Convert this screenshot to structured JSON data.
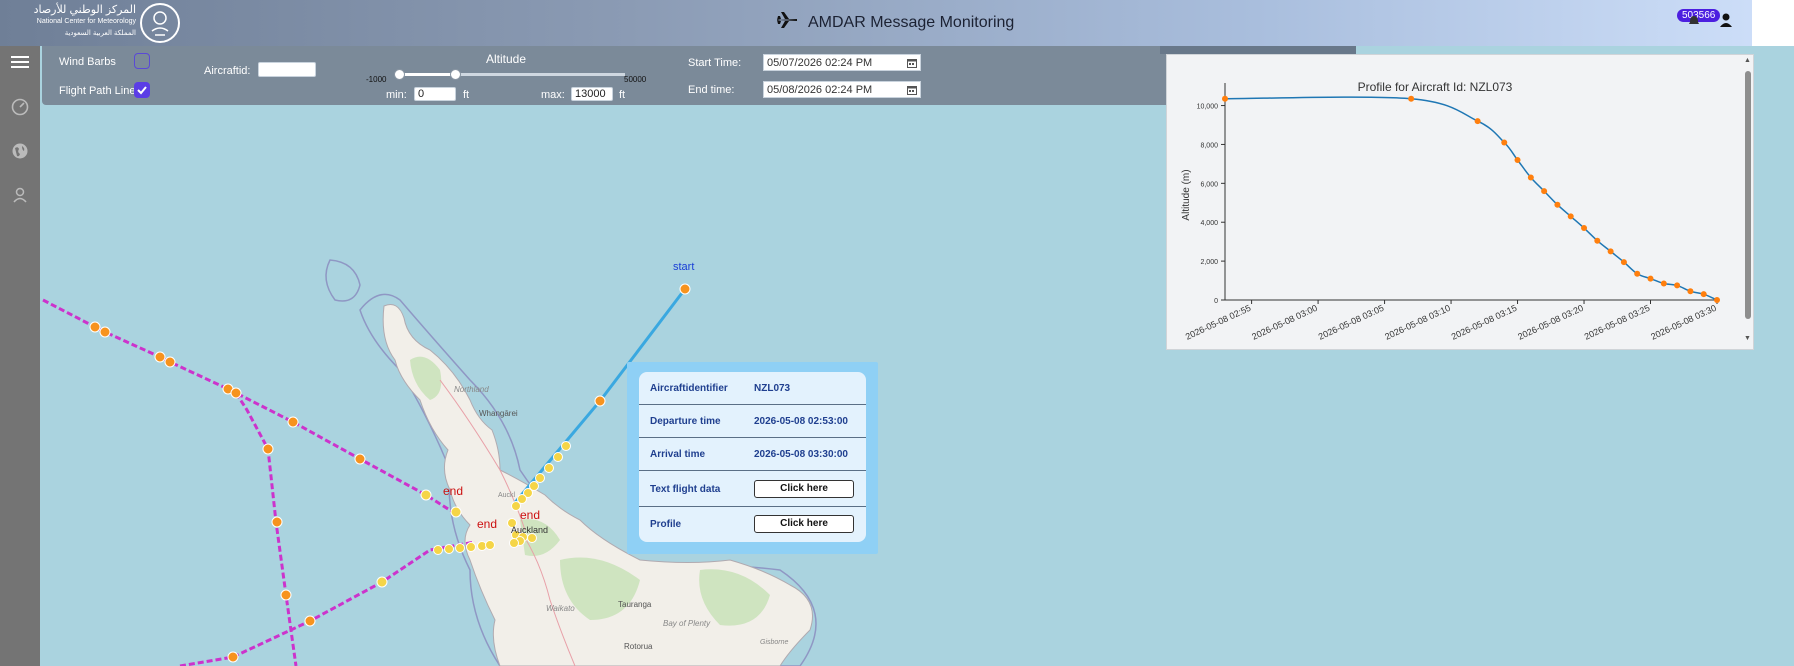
{
  "header": {
    "logo_ar": "المركز الوطني للأرصاد",
    "logo_en": "National Center for Meteorology",
    "logo_ar2": "المملكة العربية السعودية",
    "title": "AMDAR Message Monitoring",
    "badge": "503566"
  },
  "toolbar": {
    "wind_barbs_label": "Wind Barbs",
    "wind_barbs_checked": false,
    "flight_path_label": "Flight Path Line",
    "flight_path_checked": true,
    "aircraftid_label": "Aircraftid:",
    "aircraftid_value": "",
    "altitude_label": "Altitude",
    "slider_min_label": "-1000",
    "slider_max_label": "50000",
    "min_label": "min:",
    "min_value": "0",
    "max_label": "max:",
    "max_value": "13000",
    "unit": "ft",
    "start_label": "Start Time:",
    "start_value": "05/07/2026 02:24 PM",
    "end_label": "End time:",
    "end_value": "05/08/2026 02:24 PM"
  },
  "map": {
    "labels": {
      "start": "start",
      "end": "end",
      "northland": "Northland",
      "whangarei": "Whangārei",
      "auckland": "Auckland",
      "auckl": "Auckl",
      "tauranga": "Tauranga",
      "bay_of_plenty": "Bay of Plenty",
      "waikato": "Waikato",
      "rotorua": "Rotorua",
      "gisborne": "Gisborne"
    },
    "colors": {
      "water": "#aad3df",
      "land": "#f2efe9",
      "path_magenta": "#cc33cc",
      "path_blue": "#3aa8e0",
      "point_orange": "#f7931e",
      "point_yellow": "#f5d547",
      "end_text": "#cc1111",
      "start_text": "#1a3fd6"
    }
  },
  "popup": {
    "rows": [
      {
        "label": "Aircraftidentifier",
        "value": "NZL073"
      },
      {
        "label": "Departure time",
        "value": "2026-05-08 02:53:00"
      },
      {
        "label": "Arrival time",
        "value": "2026-05-08 03:30:00"
      },
      {
        "label": "Text flight data",
        "button": "Click here"
      },
      {
        "label": "Profile",
        "button": "Click here"
      }
    ]
  },
  "chart_data": {
    "type": "line",
    "title": "Profile for Aircraft Id: NZL073",
    "ylabel": "Altitude (m)",
    "xlabel": "",
    "ylim": [
      0,
      10800
    ],
    "yticks": [
      0,
      2000,
      4000,
      6000,
      8000,
      10000
    ],
    "ytick_labels": [
      "0",
      "2,000",
      "4,000",
      "6,000",
      "8,000",
      "10,000"
    ],
    "xlim": [
      "2026-05-08 02:53",
      "2026-05-08 03:30"
    ],
    "xtick_labels": [
      "2026-05-08 02:55",
      "2026-05-08 03:00",
      "2026-05-08 03:05",
      "2026-05-08 03:10",
      "2026-05-08 03:15",
      "2026-05-08 03:20",
      "2026-05-08 03:25",
      "2026-05-08 03:30"
    ],
    "xticks_min": [
      175,
      180,
      185,
      190,
      195,
      200,
      205,
      210
    ],
    "line_color": "#1f77b4",
    "marker_color": "#ff7f0e",
    "points": [
      {
        "x": "2026-05-08 02:53",
        "y": 10350
      },
      {
        "x": "2026-05-08 03:07",
        "y": 10350
      },
      {
        "x": "2026-05-08 03:12",
        "y": 9200
      },
      {
        "x": "2026-05-08 03:14",
        "y": 8100
      },
      {
        "x": "2026-05-08 03:15",
        "y": 7200
      },
      {
        "x": "2026-05-08 03:16",
        "y": 6300
      },
      {
        "x": "2026-05-08 03:17",
        "y": 5600
      },
      {
        "x": "2026-05-08 03:18",
        "y": 4900
      },
      {
        "x": "2026-05-08 03:19",
        "y": 4300
      },
      {
        "x": "2026-05-08 03:20",
        "y": 3700
      },
      {
        "x": "2026-05-08 03:21",
        "y": 3050
      },
      {
        "x": "2026-05-08 03:22",
        "y": 2500
      },
      {
        "x": "2026-05-08 03:23",
        "y": 1950
      },
      {
        "x": "2026-05-08 03:24",
        "y": 1350
      },
      {
        "x": "2026-05-08 03:25",
        "y": 1100
      },
      {
        "x": "2026-05-08 03:26",
        "y": 850
      },
      {
        "x": "2026-05-08 03:27",
        "y": 750
      },
      {
        "x": "2026-05-08 03:28",
        "y": 450
      },
      {
        "x": "2026-05-08 03:29",
        "y": 300
      },
      {
        "x": "2026-05-08 03:30",
        "y": 0
      }
    ]
  }
}
